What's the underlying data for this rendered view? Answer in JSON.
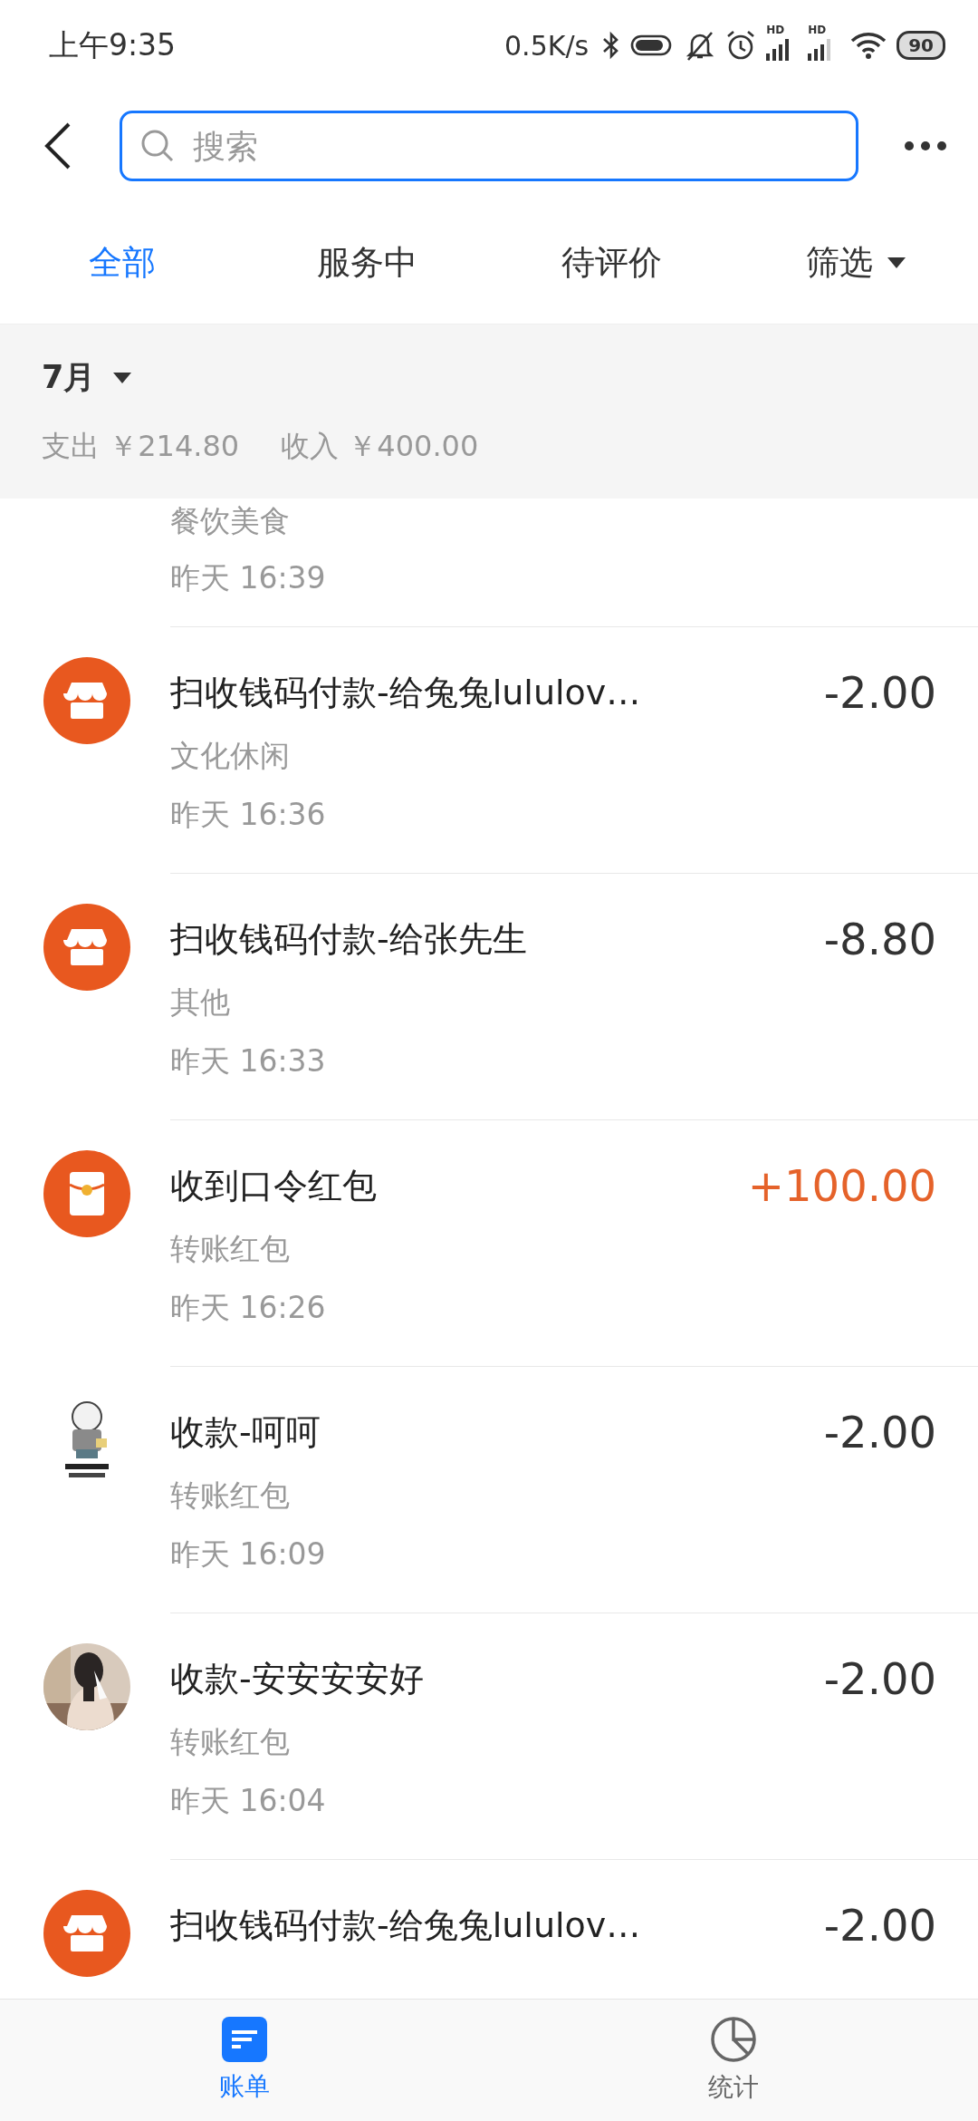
{
  "status_bar": {
    "time": "上午9:35",
    "speed": "0.5K/s",
    "signal_label_1": "HD",
    "signal_label_2": "HD",
    "battery": "90"
  },
  "search": {
    "placeholder": "搜索"
  },
  "tabs": [
    {
      "label": "全部",
      "selected": true,
      "dropdown": false
    },
    {
      "label": "服务中",
      "selected": false,
      "dropdown": false
    },
    {
      "label": "待评价",
      "selected": false,
      "dropdown": false
    },
    {
      "label": "筛选",
      "selected": false,
      "dropdown": true
    }
  ],
  "summary": {
    "month": "7月",
    "expense": "支出 ￥214.80",
    "income": "收入 ￥400.00"
  },
  "partial_item": {
    "category": "餐饮美食",
    "time": "昨天  16:39"
  },
  "transactions": [
    {
      "kind": "shop",
      "title": "扫收钱码付款-给兔兔lululov…",
      "category": "文化休闲",
      "time": "昨天  16:36",
      "amount": "-2.00",
      "income": false
    },
    {
      "kind": "shop",
      "title": "扫收钱码付款-给张先生",
      "category": "其他",
      "time": "昨天  16:33",
      "amount": "-8.80",
      "income": false
    },
    {
      "kind": "envelope",
      "title": "收到口令红包",
      "category": "转账红包",
      "time": "昨天  16:26",
      "amount": "+100.00",
      "income": true
    },
    {
      "kind": "sticker",
      "title": "收款-呵呵",
      "category": "转账红包",
      "time": "昨天  16:09",
      "amount": "-2.00",
      "income": false
    },
    {
      "title": "收款-安安安安好",
      "category": "转账红包",
      "time": "昨天  16:04",
      "amount": "-2.00",
      "income": false
    },
    {
      "kind": "shop",
      "title": "扫收钱码付款-给兔兔lululov…",
      "amount": "-2.00",
      "income": false
    }
  ],
  "bottom_nav": [
    {
      "label": "账单",
      "selected": true
    },
    {
      "label": "统计",
      "selected": false
    }
  ]
}
